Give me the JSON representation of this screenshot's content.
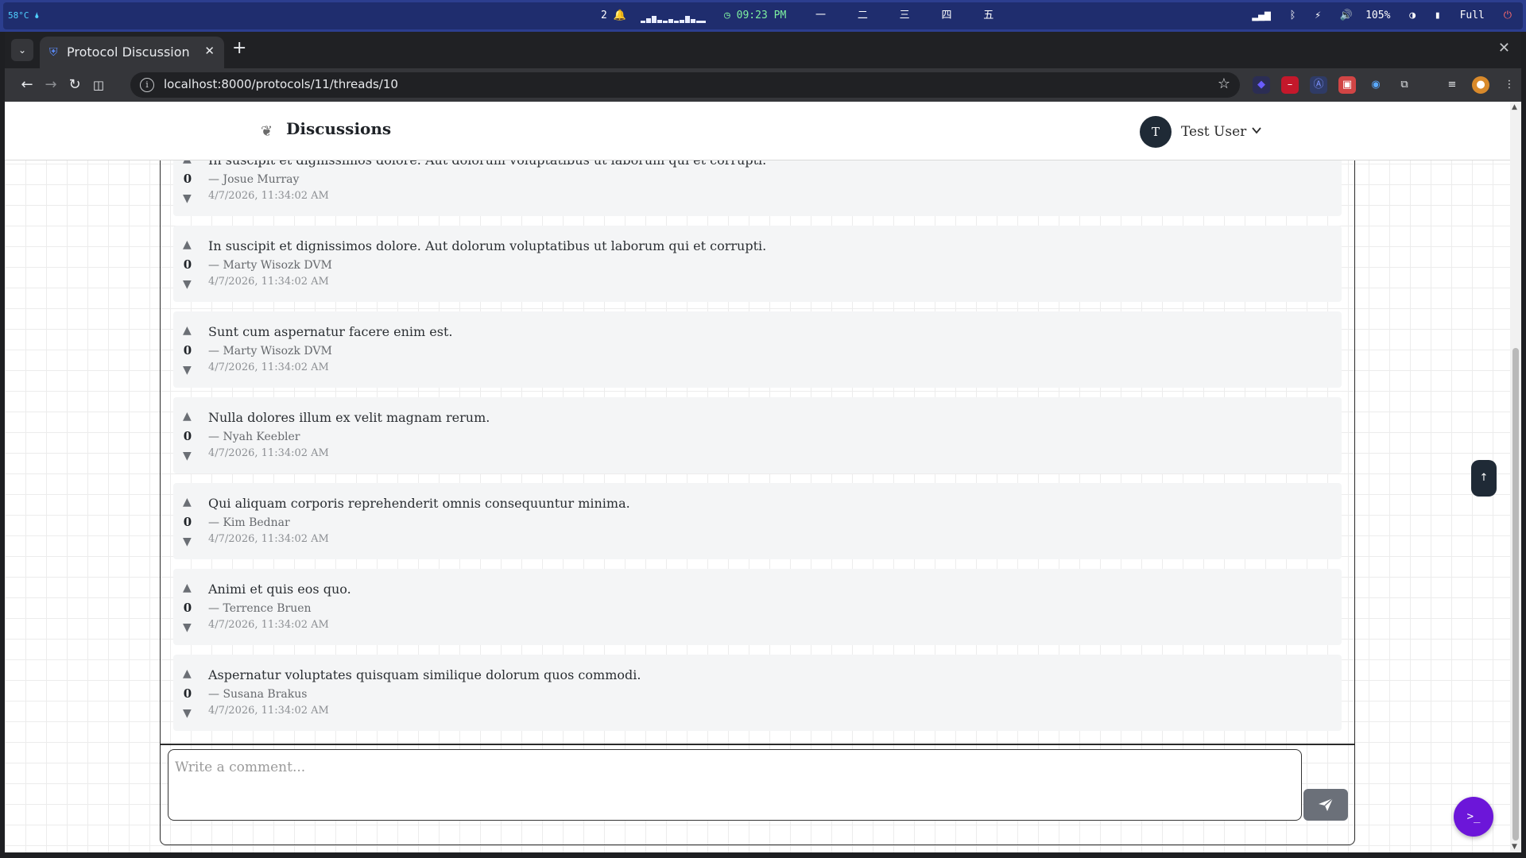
{
  "os_bar": {
    "temperature": "58°C 🌢",
    "notifications": "2 🔔",
    "clock": "09:23 PM",
    "workspaces": "一 二 三 四 五",
    "volume": "105%",
    "battery": "Full"
  },
  "browser": {
    "tab_title": "Protocol Discussion Platform",
    "url": "localhost:8000/protocols/11/threads/10"
  },
  "header": {
    "title": "Discussions",
    "user_initial": "T",
    "user_name": "Test User"
  },
  "comments": [
    {
      "votes": "0",
      "text": "In suscipit et dignissimos dolore. Aut dolorum voluptatibus ut laborum qui et corrupti.",
      "author": "— Josue Murray",
      "date": "4/7/2026, 11:34:02 AM"
    },
    {
      "votes": "0",
      "text": "In suscipit et dignissimos dolore. Aut dolorum voluptatibus ut laborum qui et corrupti.",
      "author": "— Marty Wisozk DVM",
      "date": "4/7/2026, 11:34:02 AM"
    },
    {
      "votes": "0",
      "text": "Sunt cum aspernatur facere enim est.",
      "author": "— Marty Wisozk DVM",
      "date": "4/7/2026, 11:34:02 AM"
    },
    {
      "votes": "0",
      "text": "Nulla dolores illum ex velit magnam rerum.",
      "author": "— Nyah Keebler",
      "date": "4/7/2026, 11:34:02 AM"
    },
    {
      "votes": "0",
      "text": "Qui aliquam corporis reprehenderit omnis consequuntur minima.",
      "author": "— Kim Bednar",
      "date": "4/7/2026, 11:34:02 AM"
    },
    {
      "votes": "0",
      "text": "Animi et quis eos quo.",
      "author": "— Terrence Bruen",
      "date": "4/7/2026, 11:34:02 AM"
    },
    {
      "votes": "0",
      "text": "Aspernatur voluptates quisquam similique dolorum quos commodi.",
      "author": "— Susana Brakus",
      "date": "4/7/2026, 11:34:02 AM"
    }
  ],
  "composer": {
    "placeholder": "Write a comment..."
  },
  "colors": {
    "fab": "#6c16d9",
    "send": "#6b7079",
    "avatar": "#1f2a36"
  },
  "icons": {
    "vote_up": "▲",
    "vote_down": "▼",
    "back_to_top": "↑",
    "fab": ">_"
  }
}
